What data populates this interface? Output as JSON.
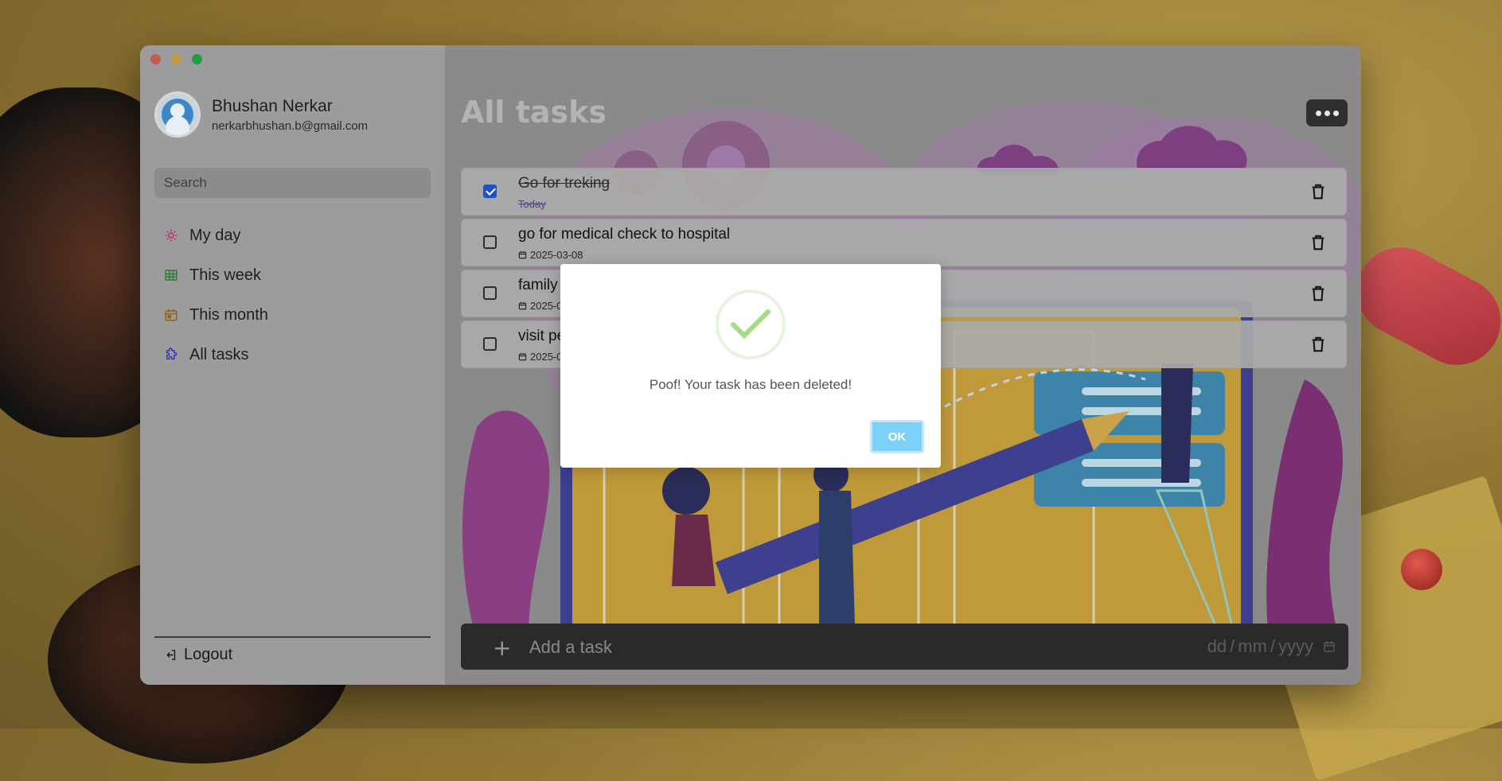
{
  "user": {
    "name": "Bhushan Nerkar",
    "email": "nerkarbhushan.b@gmail.com"
  },
  "sidebar": {
    "search_placeholder": "Search",
    "items": [
      {
        "label": "My day",
        "icon": "sun-icon",
        "color": "#c0287a"
      },
      {
        "label": "This week",
        "icon": "grid-calendar-icon",
        "color": "#2f7a3b"
      },
      {
        "label": "This month",
        "icon": "calendar-icon",
        "color": "#8a6222"
      },
      {
        "label": "All tasks",
        "icon": "puzzle-icon",
        "color": "#3a34b8"
      }
    ],
    "logout_label": "Logout"
  },
  "main": {
    "title": "All tasks",
    "tasks": [
      {
        "title": "Go for treking",
        "date": "Today",
        "completed": true
      },
      {
        "title": "go for medical check to hospital",
        "date": "2025-03-08",
        "completed": false
      },
      {
        "title": "family",
        "date": "2025-0",
        "completed": false
      },
      {
        "title": "visit pe",
        "date": "2025-0",
        "completed": false
      }
    ],
    "add_task_placeholder": "Add a task",
    "date_input": {
      "dd": "dd",
      "mm": "mm",
      "yyyy": "yyyy",
      "sep": "/"
    }
  },
  "modal": {
    "message": "Poof! Your task has been deleted!",
    "ok_label": "OK"
  },
  "colors": {
    "accent_checkbox": "#1c53c9",
    "ok_button": "#7cd1f9",
    "success_check": "#a5dc86"
  }
}
